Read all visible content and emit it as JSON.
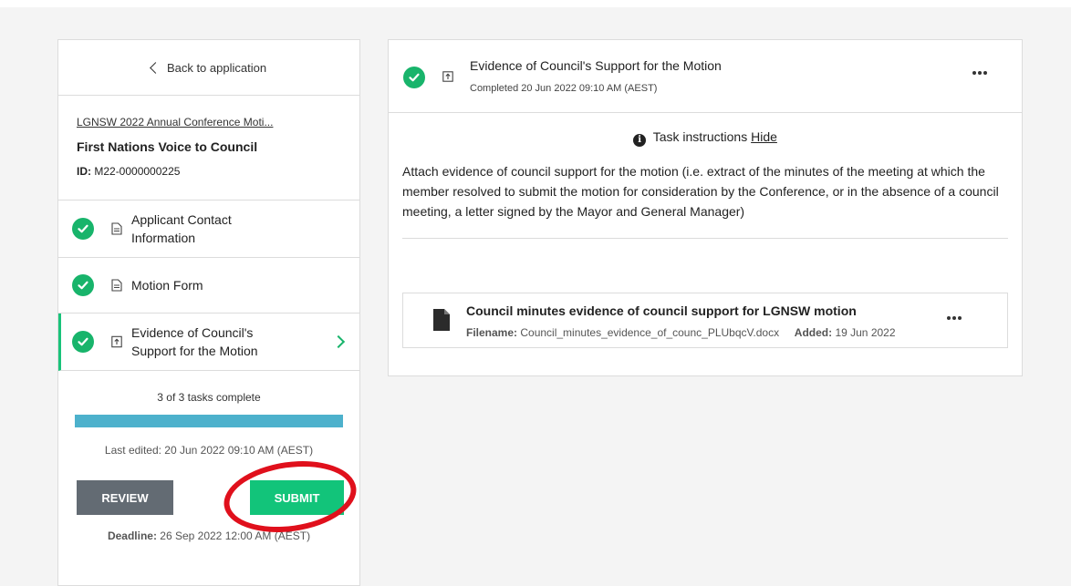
{
  "sidebar": {
    "back_label": "Back to application",
    "app_link": "LGNSW 2022 Annual Conference Moti...",
    "app_title": "First Nations Voice to Council",
    "id_label": "ID:",
    "id_value": "M22-0000000225",
    "tasks": [
      {
        "label": "Applicant Contact Information",
        "status": "complete",
        "icon": "document-icon"
      },
      {
        "label": "Motion Form",
        "status": "complete",
        "icon": "document-icon"
      },
      {
        "label": "Evidence of Council's Support for the Motion",
        "status": "complete",
        "icon": "upload-icon",
        "active": true
      }
    ],
    "progress_text": "3 of 3 tasks complete",
    "progress_fraction": 1.0,
    "last_edited": "Last edited: 20 Jun 2022 09:10 AM (AEST)",
    "review_label": "REVIEW",
    "submit_label": "SUBMIT",
    "deadline_label": "Deadline:",
    "deadline_value": "26 Sep 2022 12:00 AM (AEST)"
  },
  "main": {
    "title": "Evidence of Council's Support for the Motion",
    "completed": "Completed 20 Jun 2022 09:10 AM (AEST)",
    "instructions_label": "Task instructions",
    "hide_label": "Hide",
    "instructions_body": "Attach evidence of council support for the motion (i.e. extract of the minutes of the meeting at which the member resolved to submit the motion for consideration by the Conference, or in the absence of a council meeting, a letter signed by the Mayor and General Manager)",
    "file": {
      "title": "Council minutes evidence of council support for LGNSW motion",
      "filename_label": "Filename:",
      "filename": "Council_minutes_evidence_of_counc_PLUbqcV.docx",
      "added_label": "Added:",
      "added": "19 Jun 2022"
    }
  },
  "colors": {
    "accent_green": "#12c47a",
    "check_green": "#18b46b",
    "progress_blue": "#4db1cc",
    "review_gray": "#636b73",
    "annotation_red": "#e0101c"
  }
}
